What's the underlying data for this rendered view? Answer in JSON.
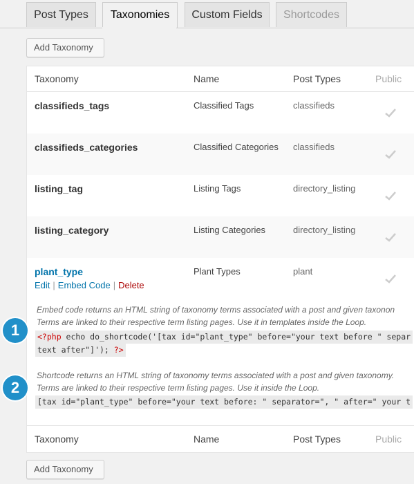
{
  "tabs": [
    {
      "label": "Post Types",
      "state": "normal"
    },
    {
      "label": "Taxonomies",
      "state": "active"
    },
    {
      "label": "Custom Fields",
      "state": "normal"
    },
    {
      "label": "Shortcodes",
      "state": "disabled"
    }
  ],
  "add_button_label": "Add Taxonomy",
  "table": {
    "headers": {
      "taxonomy": "Taxonomy",
      "name": "Name",
      "post_types": "Post Types",
      "public": "Public"
    },
    "rows": [
      {
        "taxonomy": "classifieds_tags",
        "name": "Classified Tags",
        "post_types": "classifieds",
        "public": "check-icon"
      },
      {
        "taxonomy": "classifieds_categories",
        "name": "Classified Categories",
        "post_types": "classifieds",
        "public": "check-icon"
      },
      {
        "taxonomy": "listing_tag",
        "name": "Listing Tags",
        "post_types": "directory_listing",
        "public": "check-icon"
      },
      {
        "taxonomy": "listing_category",
        "name": "Listing Categories",
        "post_types": "directory_listing",
        "public": "check-icon"
      },
      {
        "taxonomy": "plant_type",
        "name": "Plant Types",
        "post_types": "plant",
        "public": "check-icon"
      }
    ],
    "row_actions": {
      "edit": "Edit",
      "sep": "|",
      "embed": "Embed Code",
      "delete": "Delete"
    },
    "embed_info": {
      "line1": "Embed code returns an HTML string of taxonomy terms associated with a post and given taxonon",
      "line2": "Terms are linked to their respective term listing pages. Use it in templates inside the Loop.",
      "code_open": "<?php",
      "code_line1": " echo do_shortcode('[tax id=\"plant_type\" before=\"your text before \" separ",
      "code_line2": "text after\"]'); ",
      "code_close": "?>"
    },
    "shortcode_info": {
      "line1": "Shortcode returns an HTML string of taxonomy terms associated with a post and given taxonomy.",
      "line2": "Terms are linked to their respective term listing pages. Use it inside the Loop.",
      "code": "[tax id=\"plant_type\" before=\"your text before: \" separator=\", \" after=\" your t"
    }
  },
  "badges": [
    "1",
    "2"
  ],
  "colors": {
    "link": "#0073aa",
    "delete": "#a00",
    "badge": "#2190c9",
    "check": "#ccc"
  }
}
